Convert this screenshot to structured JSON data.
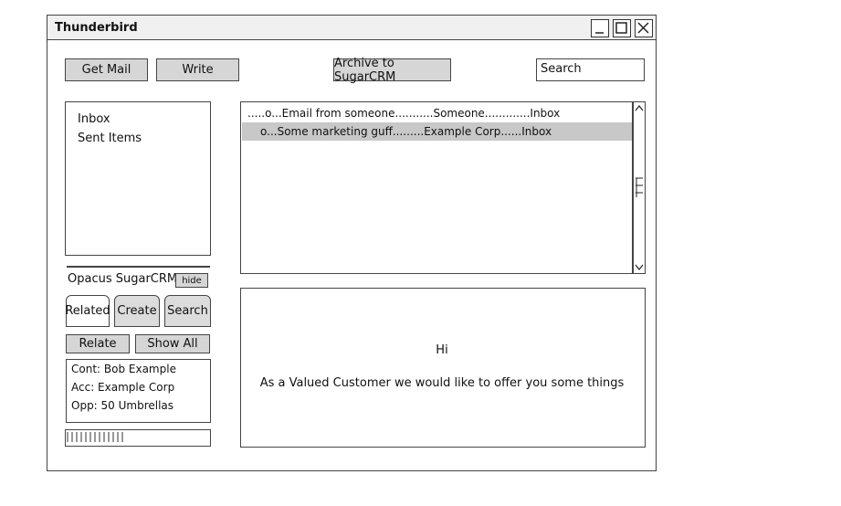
{
  "window": {
    "title": "Thunderbird"
  },
  "toolbar": {
    "get_mail": "Get Mail",
    "write": "Write",
    "archive": "Archive to SugarCRM",
    "search_value": "Search"
  },
  "folders": [
    "Inbox",
    "Sent Items"
  ],
  "messages": [
    {
      "text": ".....o...Email from someone...........Someone.............Inbox",
      "selected": false
    },
    {
      "text": "o...Some marketing guff.........Example Corp......Inbox",
      "selected": true
    }
  ],
  "preview": {
    "greeting": "Hi",
    "body": "As a Valued Customer we would like to offer you some things"
  },
  "sugarcrm": {
    "title": "Opacus SugarCRM",
    "hide": "hide",
    "tabs": [
      "Related",
      "Create",
      "Search"
    ],
    "relate": "Relate",
    "show_all": "Show All",
    "info": [
      "Cont: Bob Example",
      "Acc: Example Corp",
      "Opp: 50 Umbrellas"
    ],
    "progress": 0.42
  }
}
